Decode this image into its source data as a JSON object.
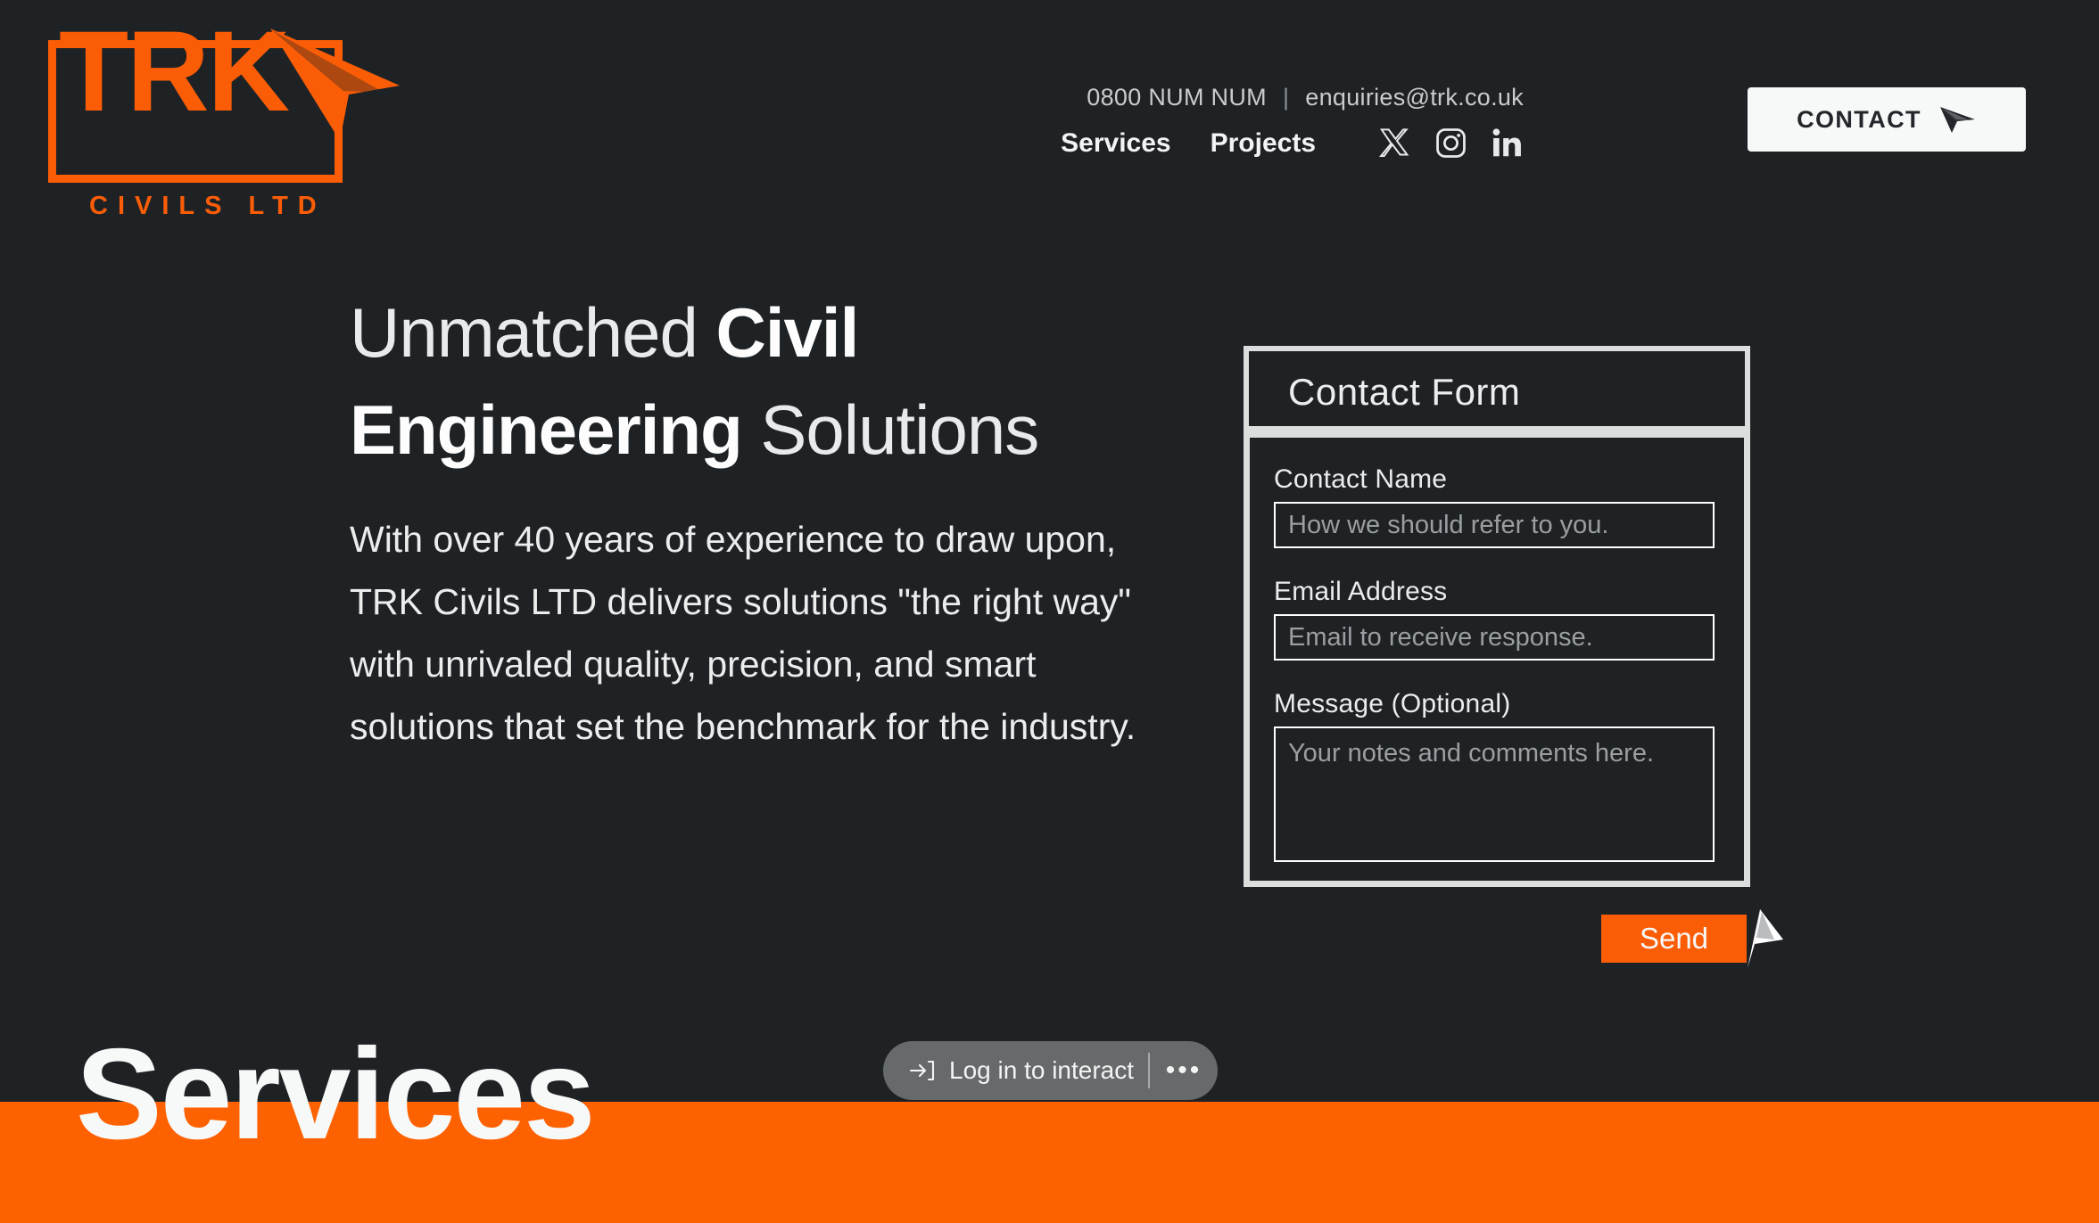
{
  "brand": {
    "logo_text": "TRK",
    "logo_subtext": "CIVILS LTD",
    "logo_arrow_icon": "paper-plane-arrow-icon",
    "accent_color": "#fb5d07",
    "band_color": "#fd6100",
    "background_color": "#1e2225"
  },
  "header": {
    "phone": "0800 NUM NUM",
    "separator": "|",
    "email": "enquiries@trk.co.uk",
    "nav_links": [
      {
        "label": "Services"
      },
      {
        "label": "Projects"
      }
    ],
    "socials": [
      {
        "name": "x-twitter-icon"
      },
      {
        "name": "instagram-icon"
      },
      {
        "name": "linkedin-icon"
      }
    ],
    "contact_button": {
      "label": "CONTACT",
      "icon": "arrow-right-icon"
    }
  },
  "hero": {
    "heading_line1_thin": "Unmatched ",
    "heading_line1_strong": "Civil",
    "heading_line2_strong": "Engineering ",
    "heading_line2_thin": "Solutions",
    "body": "With over 40 years of experience to draw upon, TRK Civils LTD delivers solutions \"the right way\" with unrivaled quality, precision, and smart solutions that set the benchmark for the industry."
  },
  "contact_form": {
    "title": "Contact Form",
    "fields": [
      {
        "label": "Contact Name",
        "placeholder": "How we should refer to you.",
        "value": ""
      },
      {
        "label": "Email Address",
        "placeholder": "Email to receive response.",
        "value": ""
      },
      {
        "label": "Message (Optional)",
        "placeholder": "Your notes and comments here.",
        "value": ""
      }
    ],
    "submit": {
      "label": "Send",
      "icon": "paper-plane-arrow-icon"
    }
  },
  "services_section": {
    "heading": "Services"
  },
  "login_overlay": {
    "icon": "login-arrow-icon",
    "label": "Log in to interact",
    "more_label": "•••"
  }
}
